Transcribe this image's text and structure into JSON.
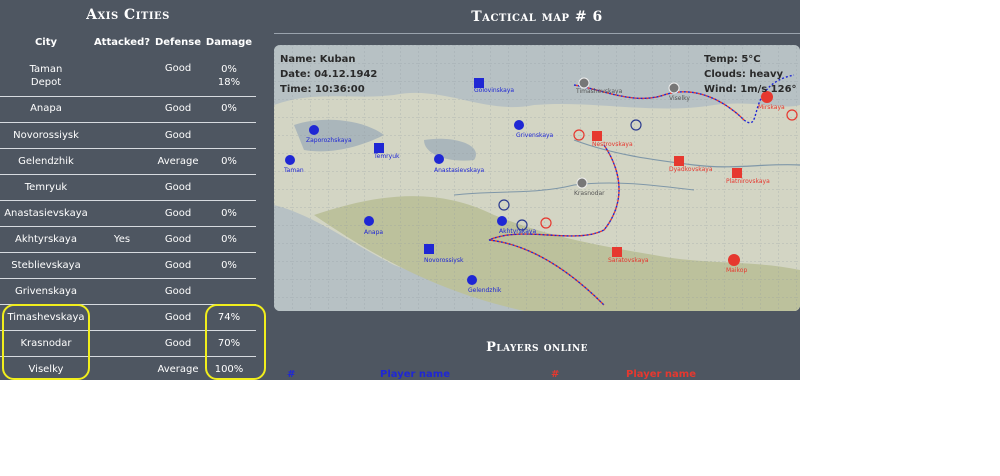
{
  "left_panel": {
    "title": "Axis Cities",
    "columns": [
      "City",
      "Attacked?",
      "Defense",
      "Damage"
    ],
    "rows": [
      {
        "city": "Taman",
        "city2": "Depot",
        "attacked": "",
        "defense": "Good",
        "damage": "0%",
        "damage2": "18%"
      },
      {
        "city": "Anapa",
        "attacked": "",
        "defense": "Good",
        "damage": "0%"
      },
      {
        "city": "Novorossiysk",
        "attacked": "",
        "defense": "Good",
        "damage": ""
      },
      {
        "city": "Gelendzhik",
        "attacked": "",
        "defense": "Average",
        "damage": "0%"
      },
      {
        "city": "Temryuk",
        "attacked": "",
        "defense": "Good",
        "damage": ""
      },
      {
        "city": "Anastasievskaya",
        "attacked": "",
        "defense": "Good",
        "damage": "0%"
      },
      {
        "city": "Akhtyrskaya",
        "attacked": "Yes",
        "defense": "Good",
        "damage": "0%"
      },
      {
        "city": "Steblievskaya",
        "attacked": "",
        "defense": "Good",
        "damage": "0%"
      },
      {
        "city": "Grivenskaya",
        "attacked": "",
        "defense": "Good",
        "damage": ""
      },
      {
        "city": "Timashevskaya",
        "attacked": "",
        "defense": "Good",
        "damage": "74%"
      },
      {
        "city": "Krasnodar",
        "attacked": "",
        "defense": "Good",
        "damage": "70%"
      },
      {
        "city": "Viselky",
        "attacked": "",
        "defense": "Average",
        "damage": "100%"
      }
    ]
  },
  "map": {
    "title": "Tactical map # 6",
    "name": "Name: Kuban",
    "date": "Date: 04.12.1942",
    "time": "Time: 10:36:00",
    "temp": "Temp: 5°C",
    "clouds": "Clouds: heavy",
    "wind": "Wind: 1m/s 126°",
    "labels": {
      "taman": "Taman",
      "zaporozhskaya": "Zaporozhskaya",
      "temryuk": "Temryuk",
      "golovinskaya": "Golovinskaya",
      "anastasievskaya": "Anastasievskaya",
      "grivenskaya": "Grivenskaya",
      "timashevskaya": "Timashevskaya",
      "viselky": "Viselky",
      "mirskaya": "Mirskaya",
      "nestrovskaya": "Nestrovskaya",
      "dyadkovskaya": "Dyadkovskaya",
      "platnirovskaya": "Platnirovskaya",
      "krasnodar": "Krasnodar",
      "anapa": "Anapa",
      "akhtyrskaya": "Akhtyrskaya",
      "novorossiysk": "Novorossiysk",
      "saratovskaya": "Saratovskaya",
      "maikop": "Maikop",
      "gelendzhik": "Gelendzhik"
    }
  },
  "players": {
    "title": "Players online",
    "blue_num": "#",
    "blue_name": "Player name",
    "red_num": "#",
    "red_name": "Player name"
  },
  "colors": {
    "background": "#4e5661",
    "highlight": "#f1ee1c",
    "allied_blue": "#1f27d4",
    "axis_red": "#e6382f"
  }
}
